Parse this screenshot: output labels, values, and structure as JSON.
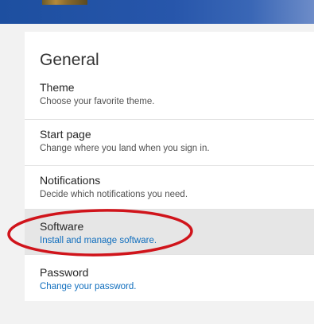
{
  "colors": {
    "link": "#106ebe",
    "highlight_row": "#e6e6e6",
    "top_bar": "#2756ab",
    "annotation_circle": "#d0141b"
  },
  "general": {
    "heading": "General",
    "items": [
      {
        "title": "Theme",
        "description": "Choose your favorite theme."
      },
      {
        "title": "Start page",
        "description": "Change where you land when you sign in."
      },
      {
        "title": "Notifications",
        "description": "Decide which notifications you need."
      },
      {
        "title": "Software",
        "description": "Install and manage software."
      },
      {
        "title": "Password",
        "description": "Change your password."
      }
    ]
  }
}
